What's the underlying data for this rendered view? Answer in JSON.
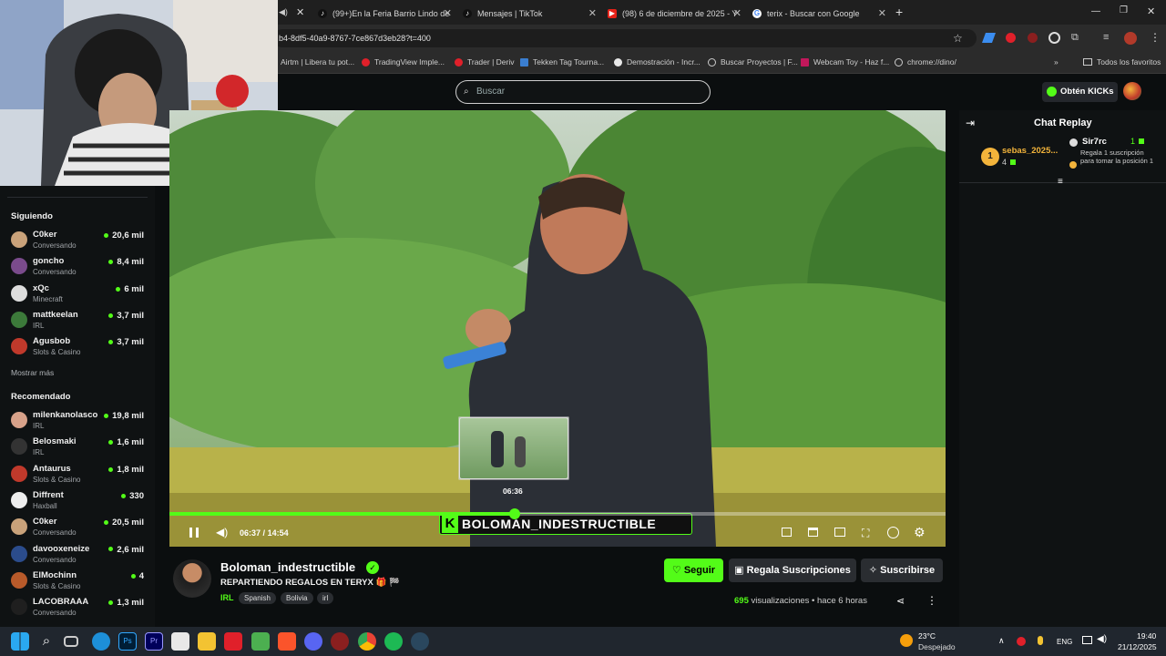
{
  "tabs": [
    {
      "title": "(99+)En la Feria Barrio Lindo de",
      "color": "#111"
    },
    {
      "title": "Mensajes | TikTok",
      "color": "#111"
    },
    {
      "title": "(98) 6 de diciembre de 2025 - Y",
      "color": "#e62117"
    },
    {
      "title": "terix - Buscar con Google",
      "color": "#4285f4"
    }
  ],
  "address": {
    "url": "b4-8df5-40a9-8767-7ce867d3eb28?t=400"
  },
  "bookmarks": [
    "Airtm | Libera tu pot...",
    "TradingView Imple...",
    "Trader | Deriv",
    "Tekken Tag Tourna...",
    "Demostración - Incr...",
    "Buscar Proyectos | F...",
    "Webcam Toy - Haz f...",
    "chrome://dino/"
  ],
  "bookmarks_all": "Todos los favoritos",
  "header": {
    "search_placeholder": "Buscar",
    "kicks_label": "Obtén KICKs"
  },
  "sidebar": {
    "following_title": "Siguiendo",
    "following": [
      {
        "name": "C0ker",
        "category": "Conversando",
        "viewers": "20,6 mil",
        "color": "#c9a27a"
      },
      {
        "name": "goncho",
        "category": "Conversando",
        "viewers": "8,4 mil",
        "color": "#7a4b8c"
      },
      {
        "name": "xQc",
        "category": "Minecraft",
        "viewers": "6 mil",
        "color": "#dddddd"
      },
      {
        "name": "mattkeelan",
        "category": "IRL",
        "viewers": "3,7 mil",
        "color": "#3c7a3a"
      },
      {
        "name": "Agusbob",
        "category": "Slots & Casino",
        "viewers": "3,7 mil",
        "color": "#c0392b"
      }
    ],
    "show_more": "Mostrar más",
    "recommended_title": "Recomendado",
    "recommended": [
      {
        "name": "milenkanolasco",
        "category": "IRL",
        "viewers": "19,8 mil",
        "color": "#d8a28a"
      },
      {
        "name": "Belosmaki",
        "category": "IRL",
        "viewers": "1,6 mil",
        "color": "#333333"
      },
      {
        "name": "Antaurus",
        "category": "Slots & Casino",
        "viewers": "1,8 mil",
        "color": "#c0392b"
      },
      {
        "name": "Diffrent",
        "category": "Haxball",
        "viewers": "330",
        "color": "#eeeeee"
      },
      {
        "name": "C0ker",
        "category": "Conversando",
        "viewers": "20,5 mil",
        "color": "#c9a27a"
      },
      {
        "name": "davooxeneize",
        "category": "Conversando",
        "viewers": "2,6 mil",
        "color": "#2b4c8c"
      },
      {
        "name": "ElMochinn",
        "category": "Slots & Casino",
        "viewers": "4",
        "color": "#b85a2a"
      },
      {
        "name": "LACOBRAAA",
        "category": "Conversando",
        "viewers": "1,3 mil",
        "color": "#1f1f1f"
      }
    ]
  },
  "player": {
    "time_current": "06:37",
    "time_total": "14:54",
    "time_separator": "/",
    "preview_time": "06:36",
    "progress": 0.445,
    "overlay_text": "BOLOMAN_INDESTRUCTIBLE"
  },
  "chat": {
    "title": "Chat Replay",
    "top_gifter": {
      "rank": "1",
      "name": "sebas_2025...",
      "count": "4"
    },
    "gift": {
      "user": "Sir7rc",
      "count": "1",
      "message": "Regala 1 suscripción para tomar la posición 1"
    }
  },
  "stream": {
    "channel": "Boloman_indestructible",
    "title": "REPARTIENDO REGALOS EN TERYX 🎁 🏁",
    "category": "IRL",
    "tags": [
      "Spanish",
      "Bolivia",
      "irl"
    ],
    "follow_label": "Seguir",
    "gift_label": "Regala Suscripciones",
    "subscribe_label": "Suscribirse",
    "views": "695",
    "views_label": "visualizaciones",
    "age": "hace 6 horas"
  },
  "taskbar": {
    "weather_temp": "23°C",
    "weather_desc": "Despejado",
    "lang": "ENG",
    "time": "19:40",
    "date": "21/12/2025"
  },
  "colors": {
    "kick_green": "#53fc18",
    "bg": "#0b0e0f"
  }
}
